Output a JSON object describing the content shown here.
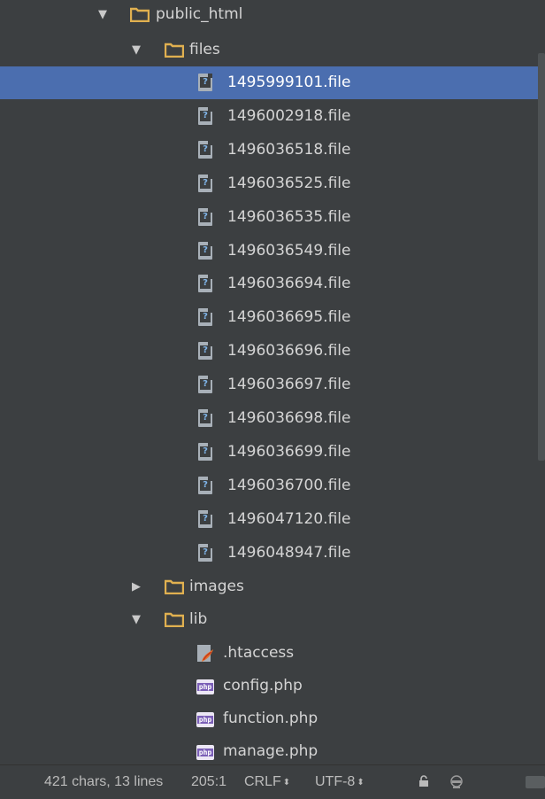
{
  "tree": {
    "public_html": {
      "label": "public_html",
      "expanded": true
    },
    "files": {
      "label": "files",
      "expanded": true
    },
    "file_items": [
      "1495999101.file",
      "1496002918.file",
      "1496036518.file",
      "1496036525.file",
      "1496036535.file",
      "1496036549.file",
      "1496036694.file",
      "1496036695.file",
      "1496036696.file",
      "1496036697.file",
      "1496036698.file",
      "1496036699.file",
      "1496036700.file",
      "1496047120.file",
      "1496048947.file"
    ],
    "selected_file": "1495999101.file",
    "images": {
      "label": "images",
      "expanded": false
    },
    "lib": {
      "label": "lib",
      "expanded": true
    },
    "lib_items": [
      {
        "label": ".htaccess",
        "icon": "htaccess-file-icon"
      },
      {
        "label": "config.php",
        "icon": "php-file-icon"
      },
      {
        "label": "function.php",
        "icon": "php-file-icon"
      },
      {
        "label": "manage.php",
        "icon": "php-file-icon"
      }
    ]
  },
  "statusbar": {
    "chars_lines": "421 chars, 13 lines",
    "position": "205:1",
    "line_separator": "CRLF",
    "encoding": "UTF-8"
  },
  "colors": {
    "background": "#3c3f41",
    "selection": "#4b6eaf",
    "folder": "#e0b050",
    "php_badge": "#7b5fb7"
  },
  "icons": {
    "unknown_file_glyph": "?",
    "php_badge_text": "php"
  }
}
